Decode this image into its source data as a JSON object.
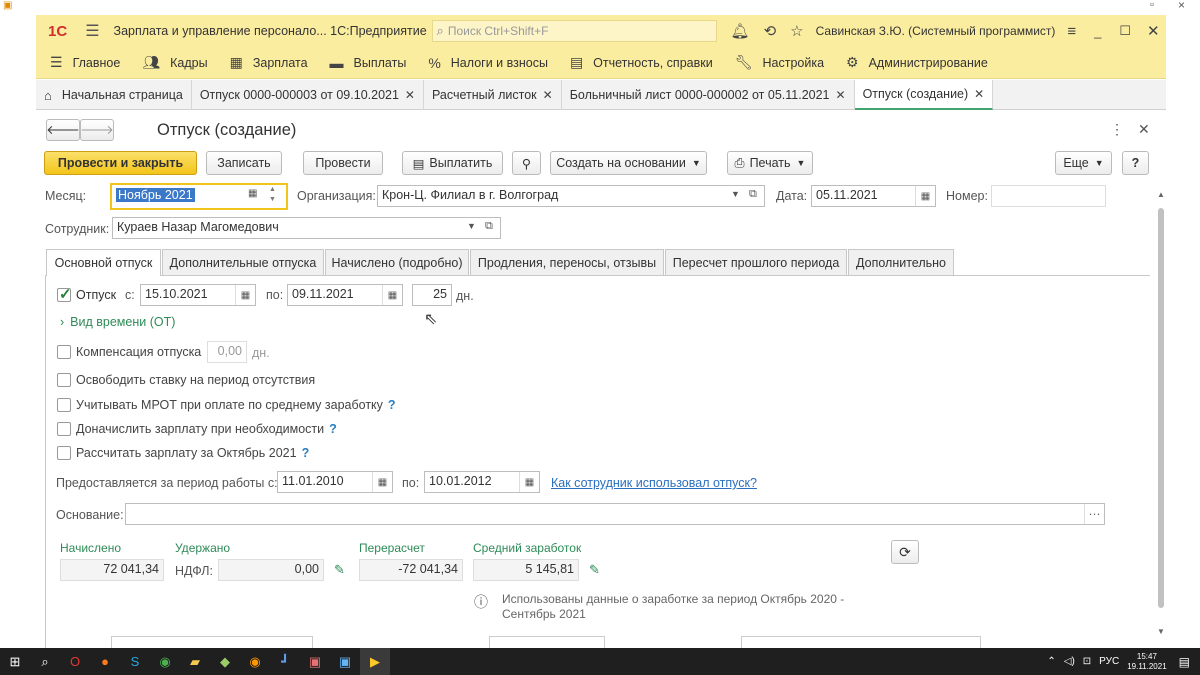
{
  "window": {
    "restore_glyph": "▫",
    "close_glyph": "×",
    "minimize_glyph": "−"
  },
  "titlebar": {
    "logo": "1С",
    "title": "Зарплата и управление персонало...  1С:Предприятие",
    "search_placeholder": "Поиск Ctrl+Shift+F",
    "user": "Савинская З.Ю. (Системный программист)"
  },
  "sections": [
    "Главное",
    "Кадры",
    "Зарплата",
    "Выплаты",
    "Налоги и взносы",
    "Отчетность, справки",
    "Настройка",
    "Администрирование"
  ],
  "page_tabs": [
    {
      "label": "Начальная страница",
      "closable": false
    },
    {
      "label": "Отпуск 0000-000003 от 09.10.2021",
      "closable": true
    },
    {
      "label": "Расчетный листок",
      "closable": true
    },
    {
      "label": "Больничный лист 0000-000002 от 05.11.2021",
      "closable": true
    },
    {
      "label": "Отпуск (создание)",
      "closable": true
    }
  ],
  "form": {
    "title": "Отпуск (создание)",
    "toolbar": {
      "post_close": "Провести и закрыть",
      "save": "Записать",
      "post": "Провести",
      "pay": "Выплатить",
      "create_based": "Создать на основании",
      "print": "Печать",
      "more": "Еще",
      "help": "?"
    },
    "month_label": "Месяц:",
    "month_value": "Ноябрь 2021",
    "org_label": "Организация:",
    "org_value": "Крон-Ц. Филиал в г. Волгоград",
    "date_label": "Дата:",
    "date_value": "05.11.2021",
    "number_label": "Номер:",
    "number_value": "",
    "employee_label": "Сотрудник:",
    "employee_value": "Кураев Назар Магомедович",
    "tabs": [
      "Основной отпуск",
      "Дополнительные отпуска",
      "Начислено (подробно)",
      "Продления, переносы, отзывы",
      "Пересчет прошлого периода",
      "Дополнительно"
    ],
    "vacation": {
      "label": "Отпуск",
      "from_label": "с:",
      "from": "15.10.2021",
      "to_label": "по:",
      "to": "09.11.2021",
      "days": "25",
      "days_unit": "дн."
    },
    "time_kind": "Вид времени (ОТ)",
    "compensation": {
      "label": "Компенсация отпуска",
      "value": "0,00",
      "unit": "дн."
    },
    "checks": [
      {
        "label": "Освободить ставку на период отсутствия",
        "help": false
      },
      {
        "label": "Учитывать МРОТ при оплате по среднему заработку",
        "help": true
      },
      {
        "label": "Доначислить зарплату при необходимости",
        "help": true
      },
      {
        "label": "Рассчитать зарплату за Октябрь 2021",
        "help": true
      }
    ],
    "period": {
      "label": "Предоставляется за период работы с:",
      "from": "11.01.2010",
      "to_label": "по:",
      "to": "10.01.2012",
      "link": "Как сотрудник использовал отпуск?"
    },
    "basis_label": "Основание:",
    "basis_value": "",
    "totals": {
      "accrued_label": "Начислено",
      "accrued": "72 041,34",
      "withheld_label": "Удержано",
      "ndfl_label": "НДФЛ:",
      "ndfl": "0,00",
      "recalc_label": "Перерасчет",
      "recalc": "-72 041,34",
      "avg_label": "Средний заработок",
      "avg": "5 145,81"
    },
    "info": "Использованы данные о заработке за период Октябрь 2020 - Сентябрь 2021"
  },
  "taskbar": {
    "lang": "РУС",
    "time": "15:47",
    "date": "19.11.2021"
  }
}
